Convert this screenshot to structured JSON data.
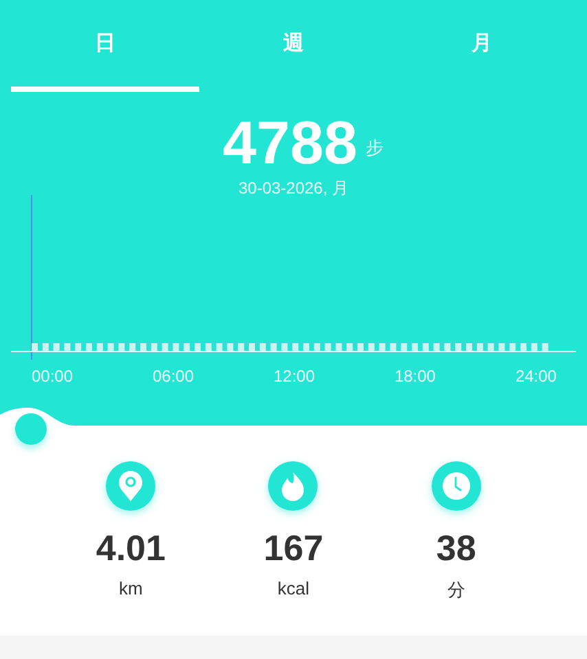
{
  "tabs": [
    {
      "label": "日",
      "selected": true
    },
    {
      "label": "週",
      "selected": false
    },
    {
      "label": "月",
      "selected": false
    }
  ],
  "summary": {
    "steps": "4788",
    "unit": "步",
    "date": "30-03-2026, 月"
  },
  "chart": {
    "x_labels": [
      "00:00",
      "06:00",
      "12:00",
      "18:00",
      "24:00"
    ]
  },
  "stats": [
    {
      "kind": "distance",
      "value": "4.01",
      "unit": "km"
    },
    {
      "kind": "calories",
      "value": "167",
      "unit": "kcal"
    },
    {
      "kind": "duration",
      "value": "38",
      "unit": "分"
    }
  ]
}
